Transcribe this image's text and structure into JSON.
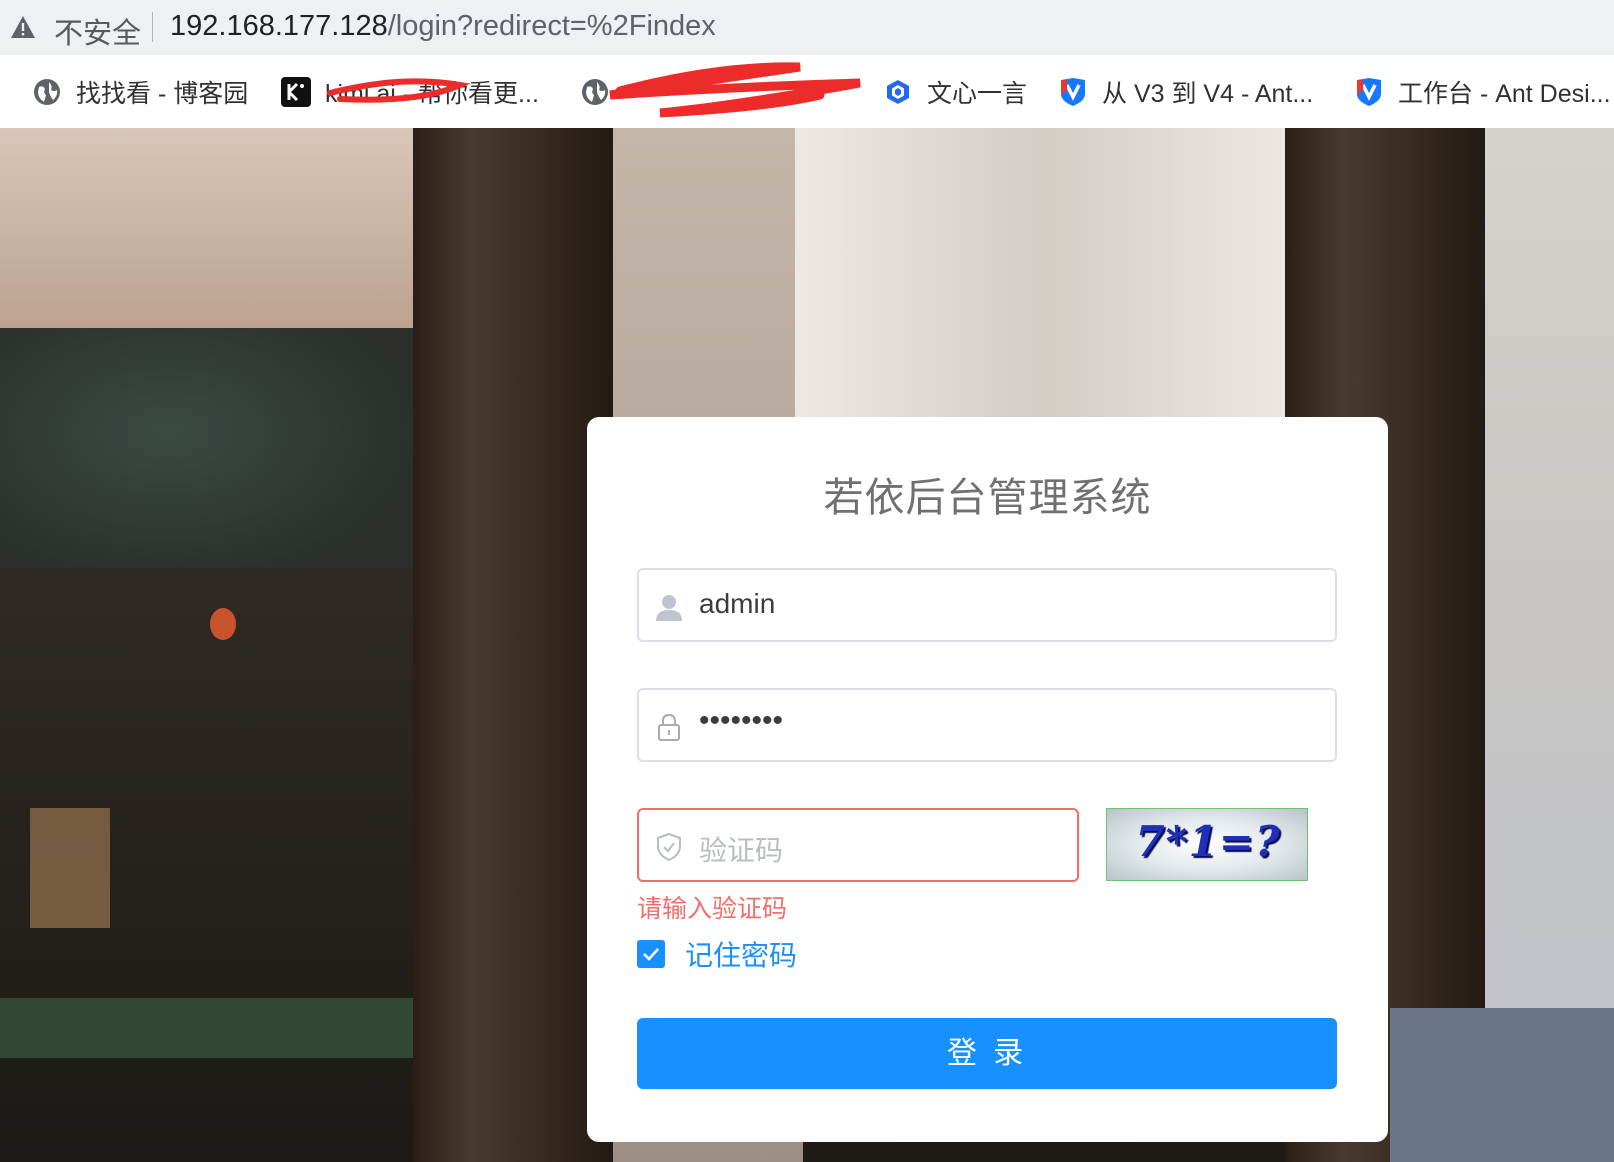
{
  "address_bar": {
    "security_label": "不安全",
    "url_host": "192.168.177.128",
    "url_path": "/login?redirect=%2Findex"
  },
  "bookmarks": [
    {
      "label": "找找看 - 博客园",
      "icon": "globe-icon"
    },
    {
      "label": "kimi.ai - 帮你看更...",
      "icon": "kimi-logo-icon"
    },
    {
      "label": "",
      "icon": "globe-icon"
    },
    {
      "label": "文心一言",
      "icon": "wenxin-logo-icon"
    },
    {
      "label": "从 V3 到 V4 - Ant...",
      "icon": "ant-design-logo-icon"
    },
    {
      "label": "工作台 - Ant Desi...",
      "icon": "ant-design-logo-icon"
    }
  ],
  "login": {
    "title": "若依后台管理系统",
    "username_value": "admin",
    "password_mask": "••••••••",
    "captcha_placeholder": "验证码",
    "captcha_error": "请输入验证码",
    "captcha_text": "7*1=?",
    "remember_label": "记住密码",
    "remember_checked": true,
    "submit_label": "登 录"
  },
  "colors": {
    "primary": "#1890ff",
    "error": "#f56c6c",
    "border": "#dcdfe6"
  }
}
